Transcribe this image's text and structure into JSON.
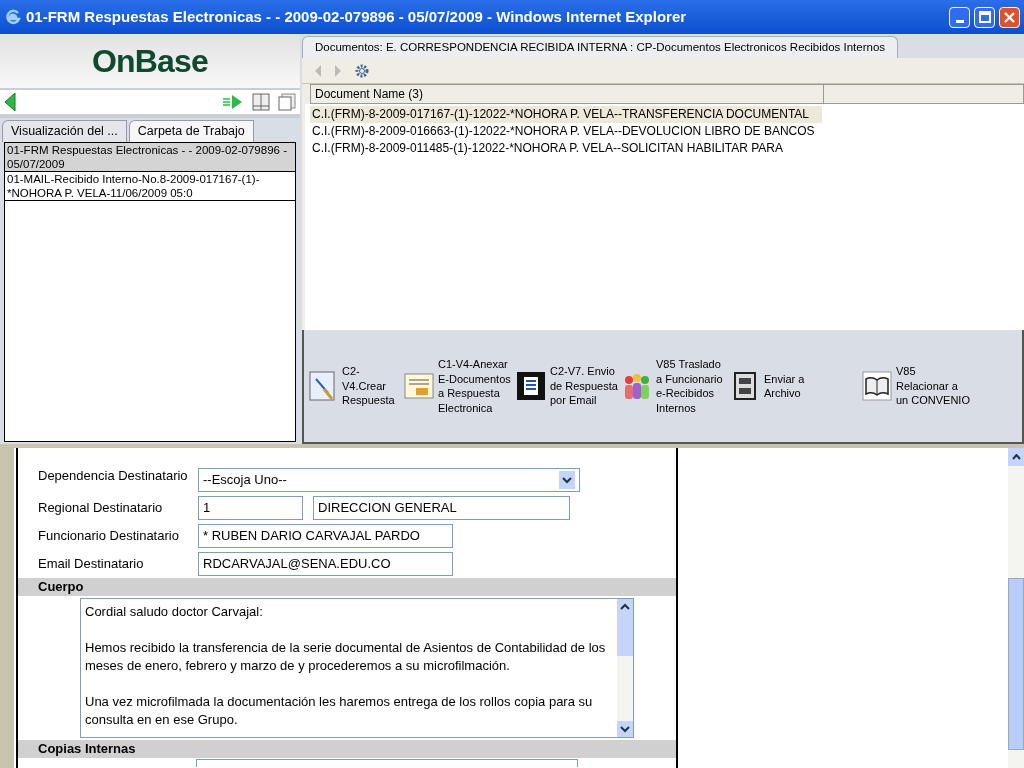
{
  "window": {
    "title": "01-FRM Respuestas Electronicas - - 2009-02-079896 - 05/07/2009 - Windows Internet Explorer"
  },
  "logo": {
    "text": "OnBase"
  },
  "left_tabs": [
    {
      "label": "Visualización del ...",
      "selected": false
    },
    {
      "label": "Carpeta de Trabajo",
      "selected": true
    }
  ],
  "left_list": [
    {
      "text": "01-FRM Respuestas Electronicas - - 2009-02-079896 - 05/07/2009",
      "selected": true
    },
    {
      "text": "01-MAIL-Recibido Interno-No.8-2009-017167-(1)-*NOHORA P. VELA-11/06/2009 05:0",
      "selected": false
    }
  ],
  "right_tab": {
    "label": "Documentos: E. CORRESPONDENCIA RECIBIDA INTERNA : CP-Documentos Electronicos Recibidos Internos"
  },
  "table": {
    "columns": [
      "Document Name (3)"
    ],
    "rows": [
      {
        "name": "C.I.(FRM)-8-2009-017167-(1)-12022-*NOHORA P. VELA--TRANSFERENCIA DOCUMENTAL",
        "selected": true
      },
      {
        "name": "C.I.(FRM)-8-2009-016663-(1)-12022-*NOHORA P. VELA--DEVOLUCION LIBRO DE BANCOS",
        "selected": false
      },
      {
        "name": "C.I.(FRM)-8-2009-011485-(1)-12022-*NOHORA P. VELA--SOLICITAN HABILITAR PARA",
        "selected": false
      }
    ]
  },
  "actions": [
    {
      "kind": "doc",
      "label": "C2-V4.Crear Respuesta"
    },
    {
      "kind": "attach",
      "label": "C1-V4-Anexar E-Documentos a Respuesta Electronica"
    },
    {
      "kind": "email",
      "label": "C2-V7. Envio de Respuesta por Email"
    },
    {
      "kind": "people",
      "label": "V85 Traslado a Funcionario e-Recibidos Internos"
    },
    {
      "kind": "cabinet",
      "label": "Enviar a Archivo"
    },
    {
      "kind": "book",
      "label": "V85 Relacionar a un CONVENIO"
    }
  ],
  "form": {
    "fields": [
      {
        "kind": "select",
        "label": "Dependencia Destinatario",
        "value": "--Escoja Uno--"
      },
      {
        "kind": "pair",
        "label": "Regional Destinatario",
        "value": "1",
        "value2": "DIRECCION GENERAL"
      },
      {
        "kind": "text",
        "label": "Funcionario Destinatario",
        "value": "* RUBEN DARIO CARVAJAL PARDO"
      },
      {
        "kind": "text",
        "label": "Email Destinatario",
        "value": "RDCARVAJAL@SENA.EDU.CO"
      }
    ],
    "sections": [
      {
        "title": "Cuerpo",
        "body": "Cordial saludo doctor Carvajal:\n\nHemos recibido la transferencia de la serie documental de Asientos de Contabilidad de los meses de enero, febrero y marzo de y procederemos a su microfilmación.\n\nUna vez microfilmada la documentación les haremos entrega de los rollos copia para su consulta en en ese Grupo."
      },
      {
        "title": "Copias Internas"
      }
    ]
  }
}
